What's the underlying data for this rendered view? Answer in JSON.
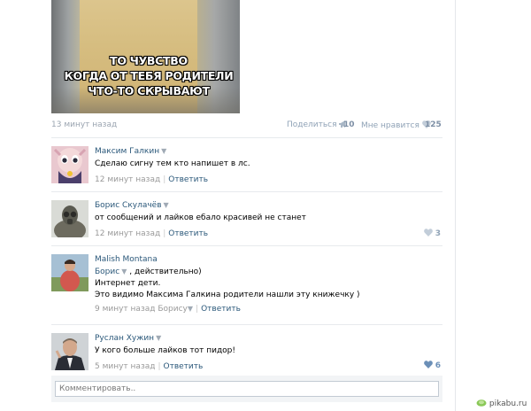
{
  "post": {
    "image_text_lines": [
      "ТО ЧУВСТВО",
      "КОГДА ОТ ТЕБЯ РОДИТЕЛИ",
      "ЧТО-ТО СКРЫВАЮТ"
    ],
    "time": "13 минут назад",
    "share_label": "Поделиться",
    "share_count": "10",
    "like_label": "Мне нравится",
    "like_count": "125"
  },
  "comments": [
    {
      "author": "Максим Галкин",
      "text": [
        "Сделаю сигну тем кто напишет в лс."
      ],
      "time": "12 минут назад",
      "reply_label": "Ответить",
      "likes": ""
    },
    {
      "author": "Борис Скулачёв",
      "text": [
        "от сообщений и лайков ебало красивей не станет"
      ],
      "time": "12 минут назад",
      "reply_label": "Ответить",
      "likes": "3"
    },
    {
      "author": "Malish Montana",
      "mention": "Борис",
      "text_after_mention": ", действительно)",
      "text": [
        "Интернет дети.",
        "Это видимо Максима Галкина родители нашли эту книжечку )"
      ],
      "time": "9 минут назад",
      "reply_to": "Борису",
      "reply_label": "Ответить",
      "likes": ""
    },
    {
      "author": "Руслан Хужин",
      "text": [
        "У кого больше лайков тот пидор!"
      ],
      "time": "5 минут назад",
      "reply_label": "Ответить",
      "likes": "6"
    }
  ],
  "reply_box": {
    "placeholder": "Комментировать.."
  },
  "watermark": "pikabu.ru",
  "colors": {
    "link": "#2b587a",
    "meta": "#999999",
    "like": "#8fa2b6"
  }
}
